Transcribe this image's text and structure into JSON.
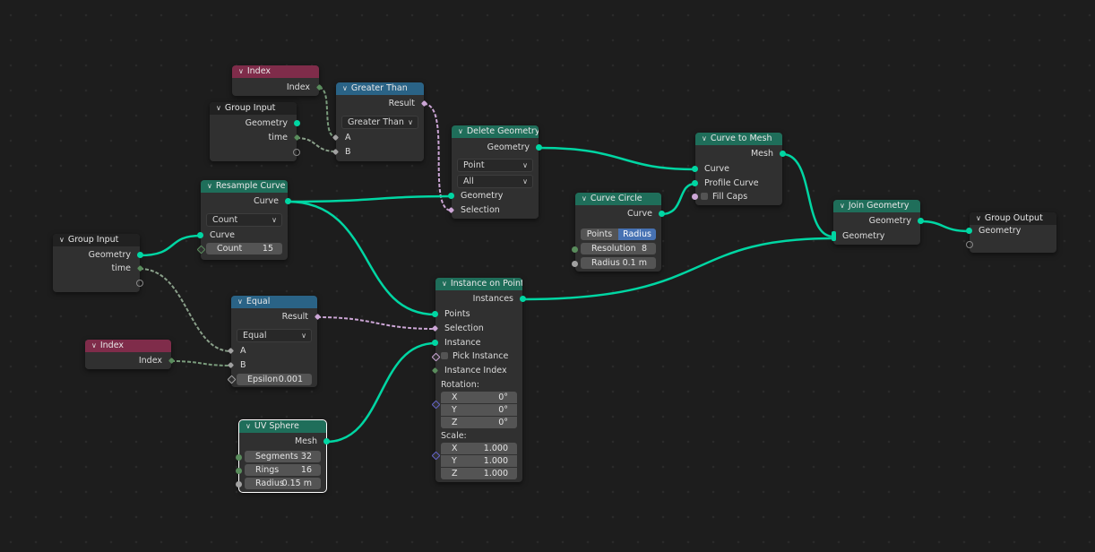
{
  "app": "Blender Geometry Nodes Editor",
  "nodes": {
    "index_top": {
      "title": "Index",
      "outputs": [
        "Index"
      ]
    },
    "group_input_top": {
      "title": "Group Input",
      "outputs": [
        "Geometry",
        "time"
      ]
    },
    "greater_than": {
      "title": "Greater Than",
      "outputs": [
        "Result"
      ],
      "mode": "Greater Than",
      "inputs": [
        "A",
        "B"
      ]
    },
    "delete_geometry": {
      "title": "Delete Geometry",
      "outputs": [
        "Geometry"
      ],
      "domain": "Point",
      "mode": "All",
      "inputs": [
        "Geometry",
        "Selection"
      ]
    },
    "resample_curve": {
      "title": "Resample Curve",
      "outputs": [
        "Curve"
      ],
      "mode": "Count",
      "inputs": [
        "Curve"
      ],
      "count_label": "Count",
      "count_value": "15"
    },
    "group_input_left": {
      "title": "Group Input",
      "outputs": [
        "Geometry",
        "time"
      ]
    },
    "equal": {
      "title": "Equal",
      "outputs": [
        "Result"
      ],
      "mode": "Equal",
      "inputs": [
        "A",
        "B"
      ],
      "epsilon_label": "Epsilon",
      "epsilon_value": "0.001"
    },
    "index_bottom": {
      "title": "Index",
      "outputs": [
        "Index"
      ]
    },
    "uv_sphere": {
      "title": "UV Sphere",
      "outputs": [
        "Mesh"
      ],
      "fields": [
        {
          "label": "Segments",
          "value": "32"
        },
        {
          "label": "Rings",
          "value": "16"
        },
        {
          "label": "Radius",
          "value": "0.15 m"
        }
      ]
    },
    "instance_on_points": {
      "title": "Instance on Points",
      "outputs": [
        "Instances"
      ],
      "inputs": [
        "Points",
        "Selection",
        "Instance",
        "Pick Instance",
        "Instance Index"
      ],
      "rotation_label": "Rotation:",
      "rotation": [
        {
          "label": "X",
          "value": "0°"
        },
        {
          "label": "Y",
          "value": "0°"
        },
        {
          "label": "Z",
          "value": "0°"
        }
      ],
      "scale_label": "Scale:",
      "scale": [
        {
          "label": "X",
          "value": "1.000"
        },
        {
          "label": "Y",
          "value": "1.000"
        },
        {
          "label": "Z",
          "value": "1.000"
        }
      ]
    },
    "curve_circle": {
      "title": "Curve Circle",
      "outputs": [
        "Curve"
      ],
      "modes": [
        "Points",
        "Radius"
      ],
      "active_mode": "Radius",
      "fields": [
        {
          "label": "Resolution",
          "value": "8"
        },
        {
          "label": "Radius",
          "value": "0.1 m"
        }
      ]
    },
    "curve_to_mesh": {
      "title": "Curve to Mesh",
      "outputs": [
        "Mesh"
      ],
      "inputs": [
        "Curve",
        "Profile Curve",
        "Fill Caps"
      ]
    },
    "join_geometry": {
      "title": "Join Geometry",
      "outputs": [
        "Geometry"
      ],
      "inputs": [
        "Geometry"
      ]
    },
    "group_output": {
      "title": "Group Output",
      "inputs": [
        "Geometry"
      ]
    }
  },
  "colors": {
    "geometry": "#00d6a3",
    "integer": "#598c5c",
    "boolean": "#cca6d6",
    "float": "#a1a1a1",
    "vector": "#6363c7",
    "header_input": "#7f2c4a",
    "header_compare": "#2a6386",
    "header_geometry": "#1f6e5a",
    "active_toggle": "#4772b3"
  }
}
